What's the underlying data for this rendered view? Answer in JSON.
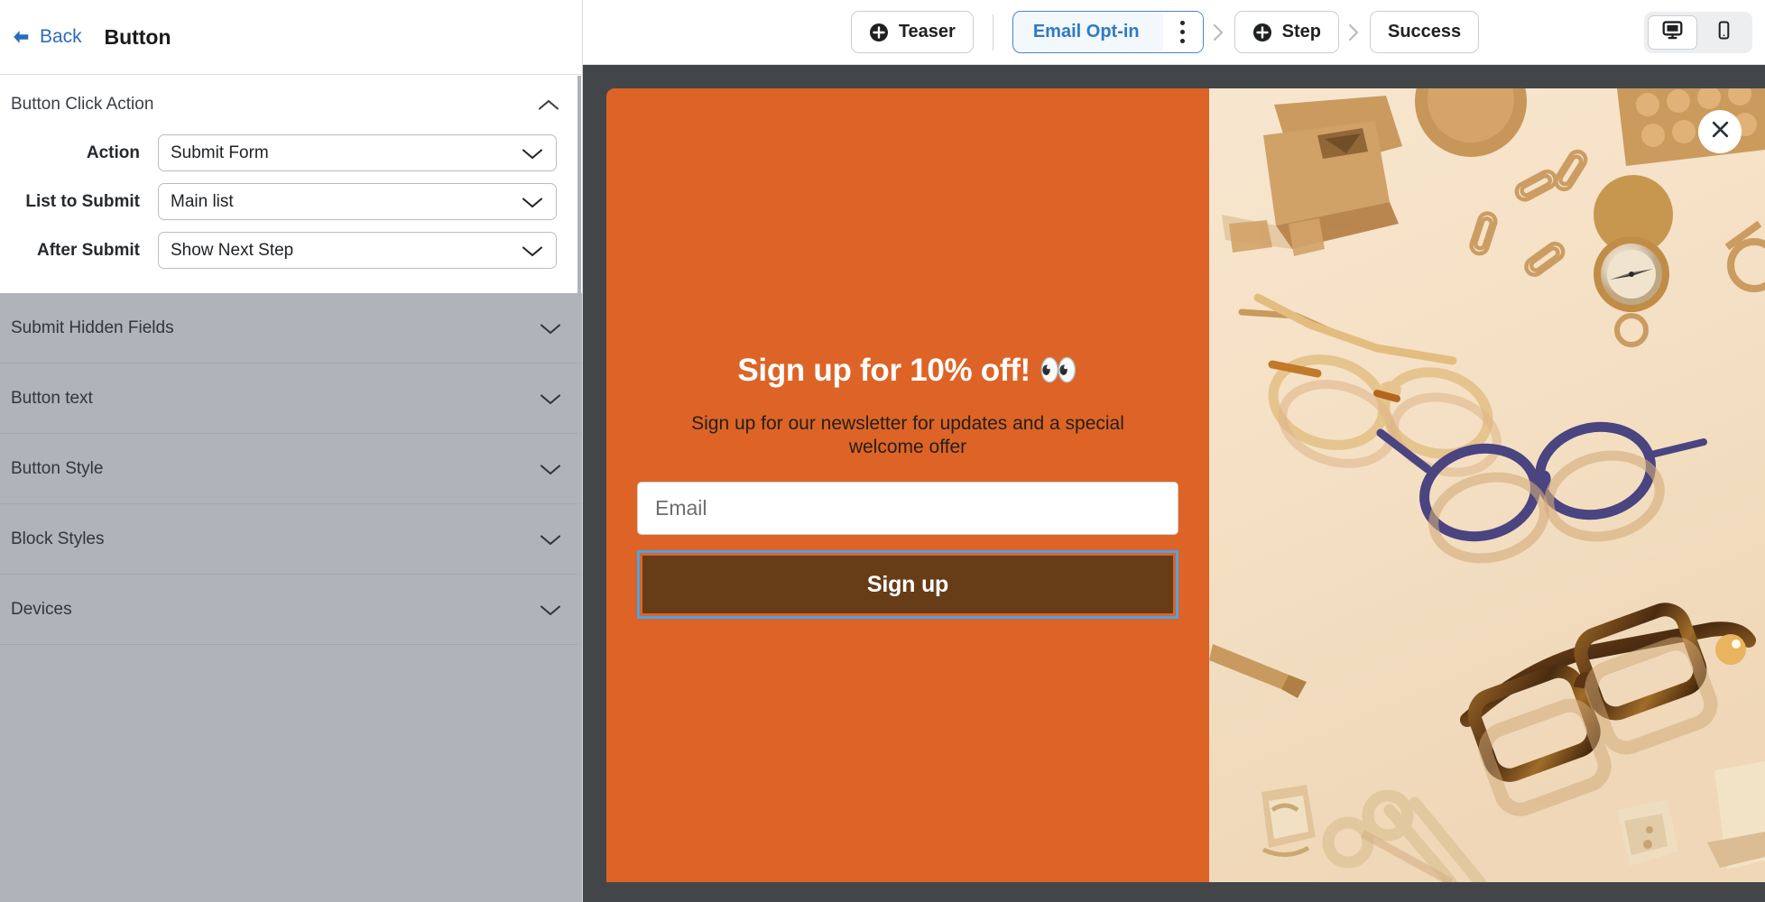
{
  "sidebar": {
    "back_label": "Back",
    "panel_title": "Button",
    "expanded_group": {
      "title": "Button Click Action",
      "chevron": "chevron-up-icon",
      "fields": [
        {
          "label": "Action",
          "value": "Submit Form",
          "chevron": "chevron-down-icon"
        },
        {
          "label": "List to Submit",
          "value": "Main list",
          "chevron": "chevron-down-icon"
        },
        {
          "label": "After Submit",
          "value": "Show Next Step",
          "chevron": "chevron-down-icon"
        }
      ]
    },
    "collapsed_groups": [
      {
        "title": "Submit Hidden Fields",
        "chevron": "chevron-down-icon"
      },
      {
        "title": "Button text",
        "chevron": "chevron-down-icon"
      },
      {
        "title": "Button Style",
        "chevron": "chevron-down-icon"
      },
      {
        "title": "Block Styles",
        "chevron": "chevron-down-icon"
      },
      {
        "title": "Devices",
        "chevron": "chevron-down-icon"
      }
    ]
  },
  "topbar": {
    "teaser_label": "Teaser",
    "email_optin_label": "Email Opt-in",
    "step_label": "Step",
    "success_label": "Success",
    "kebab_icon": "more-vertical-icon",
    "devices": [
      {
        "name": "desktop",
        "icon": "desktop-icon",
        "active": true
      },
      {
        "name": "mobile",
        "icon": "mobile-icon",
        "active": false
      }
    ]
  },
  "popup": {
    "headline": "Sign up for 10% off! 👀",
    "subhead": "Sign up for our newsletter for updates and a special welcome offer",
    "email_placeholder": "Email",
    "email_value": "",
    "signup_label": "Sign up",
    "close_icon": "close-icon"
  },
  "colors": {
    "accent_blue": "#2e7ac4",
    "popup_orange": "#dd6426",
    "button_brown": "#663d16",
    "selection_blue": "#4aa3e8",
    "canvas_gray": "#434649",
    "collapsed_gray": "#aeb4b9"
  }
}
